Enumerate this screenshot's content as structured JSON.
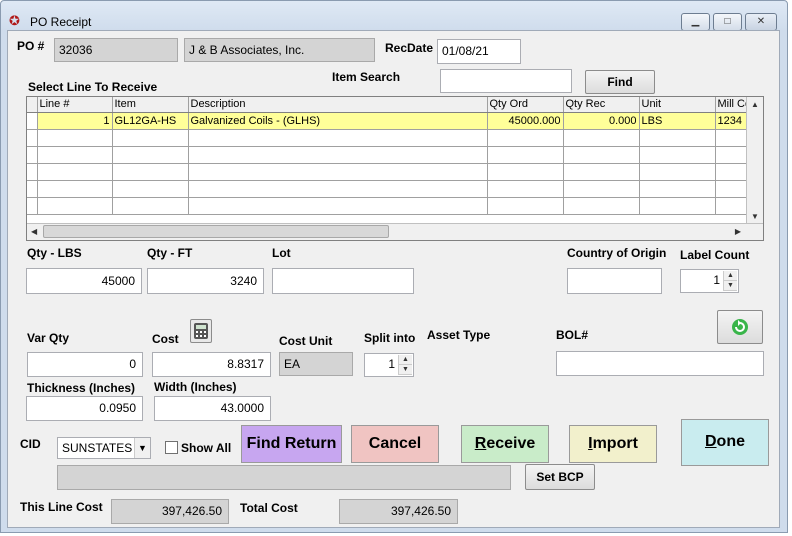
{
  "window": {
    "title": "PO Receipt",
    "controls": {
      "minimize": "▁",
      "maximize": "□",
      "close": "✕"
    }
  },
  "header": {
    "po_label": "PO #",
    "po_number": "32036",
    "vendor": "J & B Associates, Inc.",
    "recdate_label": "RecDate",
    "recdate": "01/08/21",
    "select_line_label": "Select Line To Receive",
    "item_search_label": "Item Search",
    "item_search_value": "",
    "find_label": "Find"
  },
  "grid": {
    "columns": [
      "Line #",
      "Item",
      "Description",
      "Qty Ord",
      "Qty Rec",
      "Unit",
      "Mill Co"
    ],
    "rows": [
      {
        "line": "1",
        "item": "GL12GA-HS",
        "description": "Galvanized Coils - (GLHS)",
        "qty_ord": "45000.000",
        "qty_rec": "0.000",
        "unit": "LBS",
        "mill": "1234"
      }
    ],
    "empty_rows": 6
  },
  "form": {
    "qty_lbs_label": "Qty - LBS",
    "qty_lbs": "45000",
    "qty_ft_label": "Qty - FT",
    "qty_ft": "3240",
    "lot_label": "Lot",
    "lot": "",
    "country_label": "Country of Origin",
    "country": "",
    "label_count_label": "Label Count",
    "label_count": "1",
    "var_qty_label": "Var Qty",
    "var_qty": "0",
    "cost_label": "Cost",
    "cost": "8.8317",
    "cost_unit_label": "Cost Unit",
    "cost_unit": "EA",
    "split_label": "Split into",
    "split": "1",
    "asset_type_label": "Asset Type",
    "bol_label": "BOL#",
    "bol": "",
    "thickness_label": "Thickness (Inches)",
    "thickness": "0.0950",
    "width_label": "Width (Inches)",
    "width": "43.0000",
    "cid_label": "CID",
    "cid": "SUNSTATES",
    "show_all_label": "Show All",
    "set_bcp_label": "Set BCP",
    "this_line_cost_label": "This Line Cost",
    "this_line_cost": "397,426.50",
    "total_cost_label": "Total Cost",
    "total_cost": "397,426.50"
  },
  "actions": {
    "find_return": "Find Return",
    "cancel": "Cancel",
    "receive_first": "R",
    "receive_rest": "eceive",
    "import_first": "I",
    "import_rest": "mport",
    "done_first": "D",
    "done_rest": "one"
  },
  "colors": {
    "find_return": "#c7a6f0",
    "cancel": "#f0c4c2",
    "receive": "#c9ecc9",
    "import": "#f2f0cc",
    "done": "#c9ecef",
    "selected_row": "#ffff99"
  }
}
